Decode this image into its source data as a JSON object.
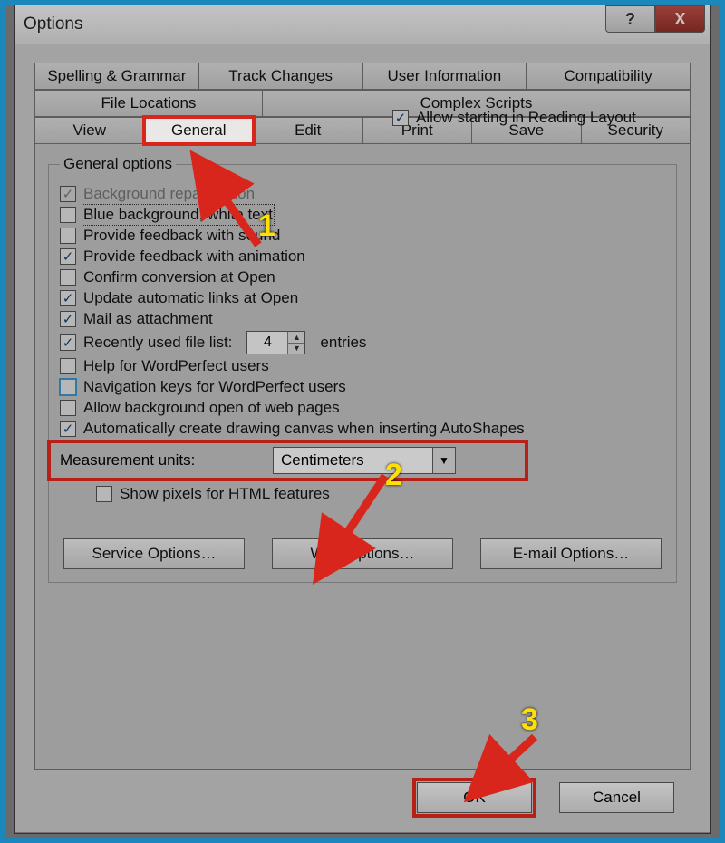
{
  "window": {
    "title": "Options",
    "help_glyph": "?",
    "close_glyph": "X"
  },
  "tabs": {
    "row1": [
      "Spelling & Grammar",
      "Track Changes",
      "User Information",
      "Compatibility"
    ],
    "row2": [
      "File Locations",
      "Complex Scripts"
    ],
    "row3": [
      "View",
      "General",
      "Edit",
      "Print",
      "Save",
      "Security"
    ],
    "active": "General"
  },
  "group": {
    "legend": "General options"
  },
  "options": {
    "left": [
      {
        "label": "Background repagination",
        "checked": true,
        "disabled": true
      },
      {
        "label": "Blue background, white text",
        "checked": false,
        "focused": true
      },
      {
        "label": "Provide feedback with sound",
        "checked": false
      },
      {
        "label": "Provide feedback with animation",
        "checked": true
      },
      {
        "label": "Confirm conversion at Open",
        "checked": false
      },
      {
        "label": "Update automatic links at Open",
        "checked": true
      },
      {
        "label": "Mail as attachment",
        "checked": true
      },
      {
        "label": "Recently used file list:",
        "checked": true,
        "spinner": true
      },
      {
        "label": "Help for WordPerfect users",
        "checked": false
      },
      {
        "label": "Navigation keys for WordPerfect users",
        "checked": false,
        "navcb": true
      },
      {
        "label": "Allow background open of web pages",
        "checked": false
      },
      {
        "label": "Automatically create drawing canvas when inserting AutoShapes",
        "checked": true
      }
    ],
    "right": [
      {
        "label": "Allow starting in Reading Layout",
        "checked": true
      }
    ],
    "spinner_value": "4",
    "spinner_suffix": "entries"
  },
  "measurement": {
    "label": "Measurement units:",
    "value": "Centimeters"
  },
  "show_pixels": {
    "label": "Show pixels for HTML features",
    "checked": false
  },
  "service_buttons": {
    "service": "Service Options…",
    "web": "Web Options…",
    "email": "E-mail Options…"
  },
  "dialog_buttons": {
    "ok": "OK",
    "cancel": "Cancel"
  },
  "annotations": {
    "step1": "1",
    "step2": "2",
    "step3": "3",
    "highlight_color": "#d9261c"
  }
}
